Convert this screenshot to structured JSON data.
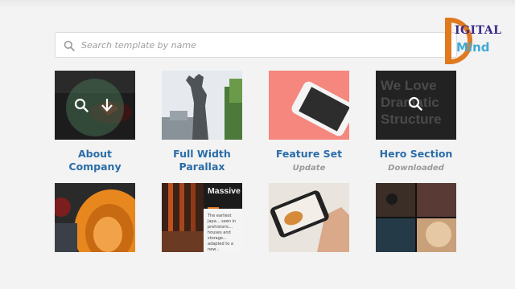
{
  "search": {
    "placeholder": "Search template by name"
  },
  "logo": {
    "line1": "IGITAL",
    "line2": "Mind",
    "letter": "D"
  },
  "templates": [
    {
      "title": "About Company",
      "status": "",
      "hover_icons": [
        "search-icon",
        "download-icon"
      ]
    },
    {
      "title": "Full Width Parallax",
      "status": ""
    },
    {
      "title": "Feature Set",
      "status": "Update"
    },
    {
      "title": "Hero Section",
      "status": "Downloaded",
      "thumb_text": "We Love Dramatic Structure"
    },
    {
      "title": "",
      "status": ""
    },
    {
      "title": "",
      "status": "",
      "thumb_heading": "Massive Structure",
      "thumb_text": "The earliest Japa... seen in prehistoric... houses and storage... adapted to a new..."
    },
    {
      "title": "",
      "status": ""
    },
    {
      "title": "",
      "status": ""
    }
  ],
  "colors": {
    "title": "#2b6da8",
    "status": "#9a9a9a",
    "logo_orange": "#e07a1f",
    "logo_purple": "#3c2a8a",
    "logo_blue": "#3fa9d6"
  }
}
